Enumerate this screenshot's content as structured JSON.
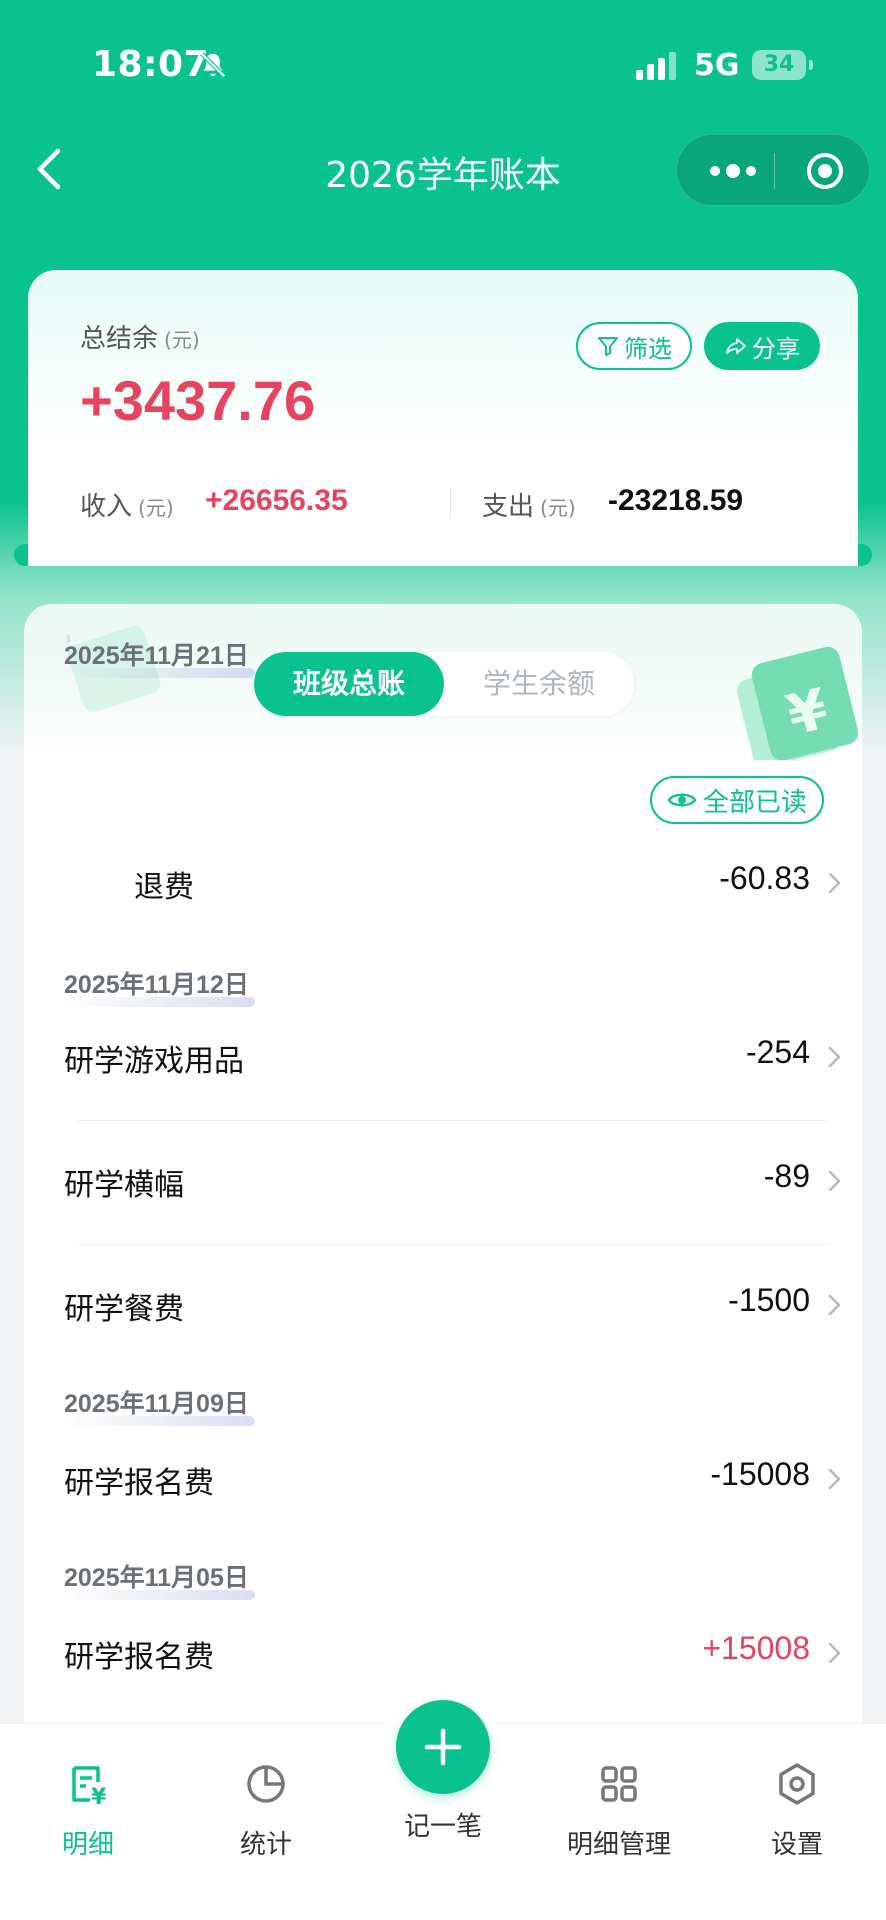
{
  "status_bar": {
    "time": "18:07",
    "network": "5G",
    "battery": "34"
  },
  "nav": {
    "title": "2026学年账本"
  },
  "summary": {
    "total_label": "总结余",
    "unit": "(元)",
    "total_value": "+3437.76",
    "filter_label": "筛选",
    "share_label": "分享",
    "income_label": "收入",
    "income_value": "+26656.35",
    "expense_label": "支出",
    "expense_value": "-23218.59"
  },
  "segment": {
    "active": "班级总账",
    "inactive": "学生余额"
  },
  "list": {
    "read_all_label": "全部已读",
    "groups": [
      {
        "date": "2025年11月21日",
        "items": [
          {
            "title": "退费",
            "amount": "-60.83"
          }
        ]
      },
      {
        "date": "2025年11月12日",
        "items": [
          {
            "title": "研学游戏用品",
            "amount": "-254"
          },
          {
            "title": "研学横幅",
            "amount": "-89"
          },
          {
            "title": "研学餐费",
            "amount": "-1500"
          }
        ]
      },
      {
        "date": "2025年11月09日",
        "items": [
          {
            "title": "研学报名费",
            "amount": "-15008"
          }
        ]
      },
      {
        "date": "2025年11月05日",
        "items": [
          {
            "title": "研学报名费",
            "amount": "+15008"
          }
        ]
      }
    ]
  },
  "tabbar": {
    "items": [
      {
        "label": "明细",
        "icon": "ledger-icon",
        "active": true
      },
      {
        "label": "统计",
        "icon": "pie-chart-icon",
        "active": false
      },
      {
        "label": "记一笔",
        "icon": "plus-icon",
        "active": false
      },
      {
        "label": "明细管理",
        "icon": "grid-icon",
        "active": false
      },
      {
        "label": "设置",
        "icon": "settings-hexagon-icon",
        "active": false
      }
    ]
  },
  "colors": {
    "brand": "#0ac28d",
    "positive": "#e6445e",
    "text": "#111111"
  }
}
